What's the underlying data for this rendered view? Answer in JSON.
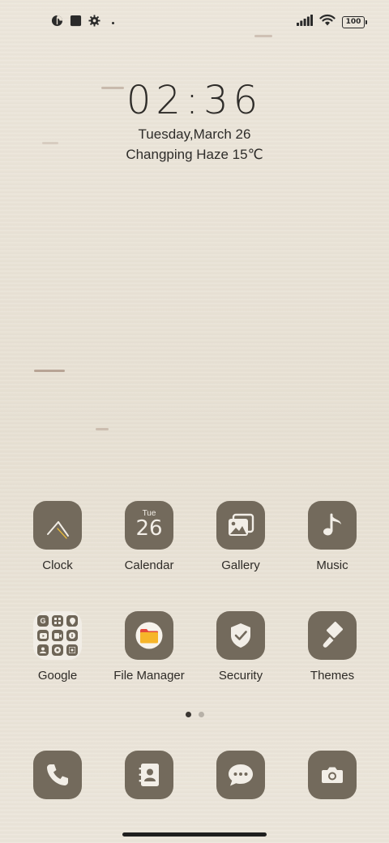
{
  "status_bar": {
    "battery_level": "100",
    "icons": [
      "data-saver-icon",
      "square-notification-icon",
      "gear-icon",
      "dot-icon",
      "signal-icon",
      "wifi-icon",
      "battery-icon"
    ]
  },
  "clock_widget": {
    "time": "02:36",
    "date": "Tuesday,March 26",
    "weather": "Changping Haze 15℃"
  },
  "apps": {
    "row1": [
      {
        "label": "Clock",
        "icon": "clock-icon"
      },
      {
        "label": "Calendar",
        "icon": "calendar-icon",
        "day_of_week": "Tue",
        "day": "26"
      },
      {
        "label": "Gallery",
        "icon": "gallery-icon"
      },
      {
        "label": "Music",
        "icon": "music-note-icon"
      }
    ],
    "row2": [
      {
        "label": "Google",
        "icon": "google-folder-icon"
      },
      {
        "label": "File Manager",
        "icon": "folder-icon"
      },
      {
        "label": "Security",
        "icon": "shield-check-icon"
      },
      {
        "label": "Themes",
        "icon": "paint-brush-icon"
      }
    ]
  },
  "page_indicator": {
    "pages": 2,
    "current": 1
  },
  "dock": [
    {
      "icon": "phone-icon"
    },
    {
      "icon": "contacts-icon"
    },
    {
      "icon": "messages-icon"
    },
    {
      "icon": "camera-icon"
    }
  ],
  "colors": {
    "tile": "#736a5c",
    "tile_icon": "#f2eee7",
    "wallpaper": "#e9e2d6",
    "file_manager_accent": "#f6b52a",
    "file_manager_red": "#e4483b"
  }
}
